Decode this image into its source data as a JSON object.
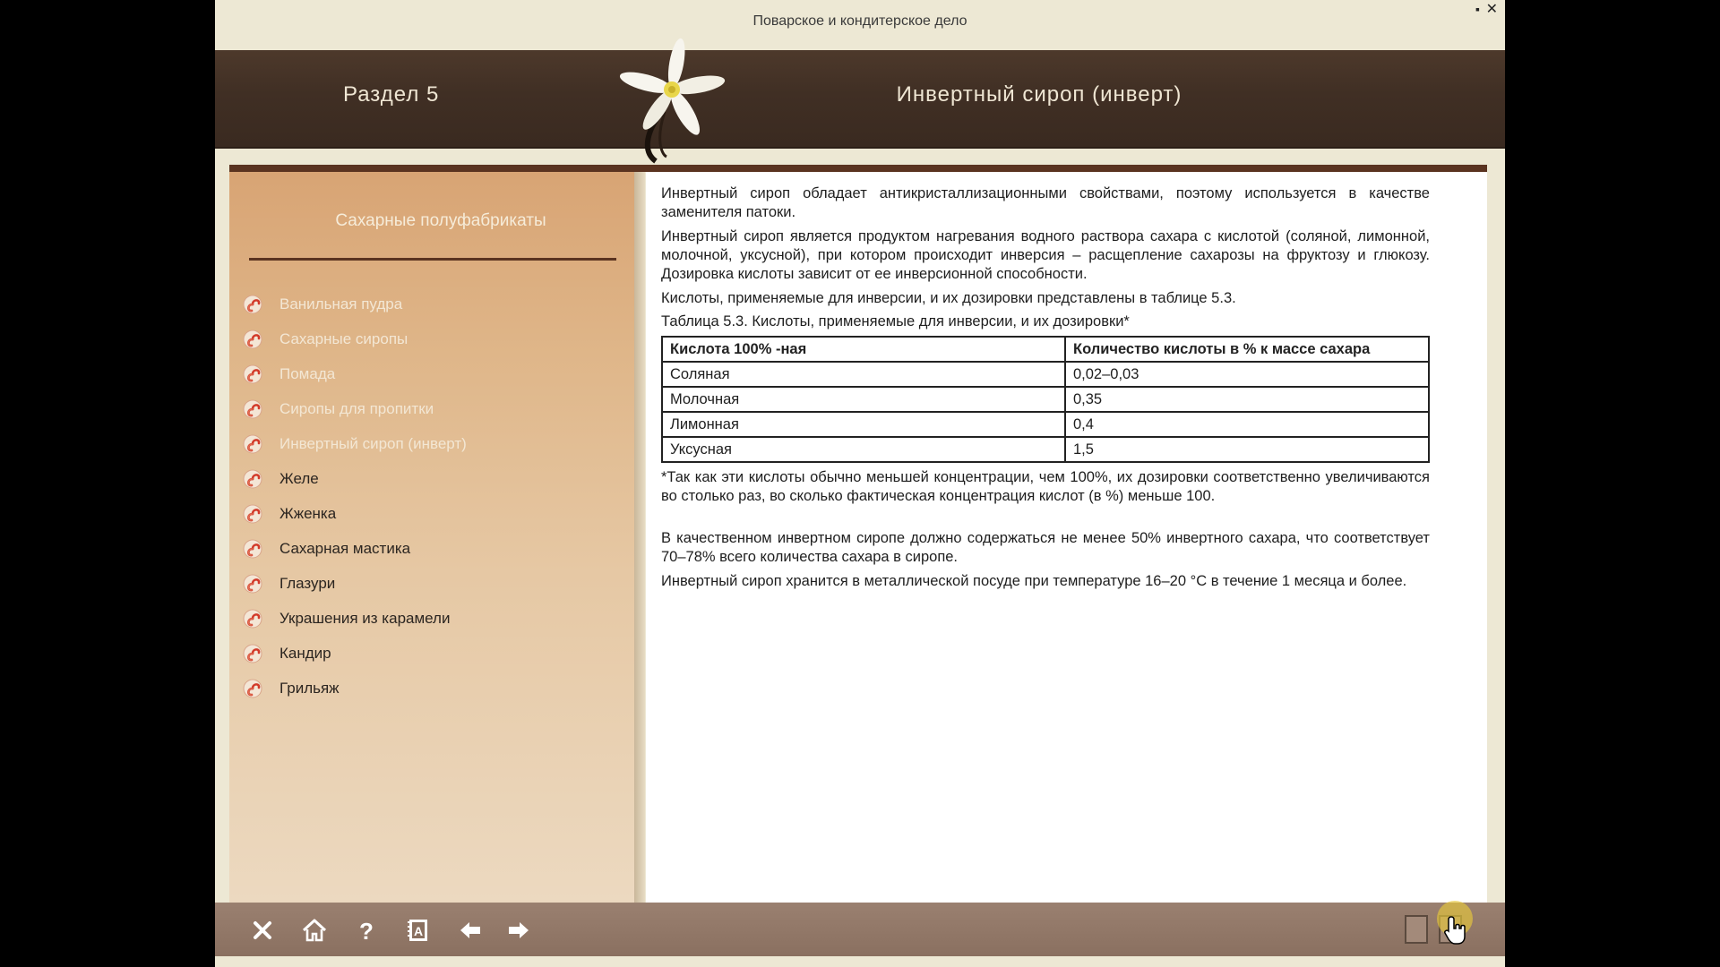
{
  "app": {
    "title": "Поварское и кондитерское дело",
    "minimize_glyph": "▪",
    "close_glyph": "✕"
  },
  "header": {
    "section": "Раздел 5",
    "topic": "Инвертный сироп (инверт)"
  },
  "sidebar": {
    "title": "Сахарные полуфабрикаты",
    "items": [
      {
        "label": "Ванильная пудра",
        "visited": true
      },
      {
        "label": "Сахарные сиропы",
        "visited": true
      },
      {
        "label": "Помада",
        "visited": true
      },
      {
        "label": "Сиропы для пропитки",
        "visited": true
      },
      {
        "label": "Инвертный сироп (инверт)",
        "visited": true
      },
      {
        "label": "Желе",
        "visited": false
      },
      {
        "label": "Жженка",
        "visited": false
      },
      {
        "label": "Сахарная мастика",
        "visited": false
      },
      {
        "label": "Глазури",
        "visited": false
      },
      {
        "label": "Украшения из карамели",
        "visited": false
      },
      {
        "label": "Кандир",
        "visited": false
      },
      {
        "label": "Грильяж",
        "visited": false
      }
    ]
  },
  "content": {
    "p1": "Инвертный сироп обладает антикристаллизационными свойствами, поэтому используется в качестве заменителя патоки.",
    "p2": "Инвертный сироп является продуктом нагревания водного раствора сахара с кислотой (соляной, лимонной, молочной, уксусной), при котором происходит инверсия – расщепление сахарозы на фруктозу и глюкозу. Дозировка кислоты зависит от ее инверсионной способности.",
    "p3": "Кислоты, применяемые для инверсии, и их дозировки представлены в таблице 5.3.",
    "table_caption": "Таблица 5.3. Кислоты, применяемые для инверсии, и их дозировки*",
    "table": {
      "headers": [
        "Кислота 100% -ная",
        "Количество кислоты в % к массе сахара"
      ],
      "rows": [
        [
          "Соляная",
          "0,02–0,03"
        ],
        [
          "Молочная",
          "0,35"
        ],
        [
          "Лимонная",
          "0,4"
        ],
        [
          "Уксусная",
          "1,5"
        ]
      ]
    },
    "footnote": "*Так как эти кислоты обычно меньшей концентрации, чем 100%, их дозировки соответственно увеличиваются во столько раз, во сколько фактическая концентрация кислот (в %) меньше 100.",
    "p4": "В качественном инвертном сиропе должно содержаться не менее 50% инвертного сахара, что соответствует 70–78% всего количества сахара в сиропе.",
    "p5": "Инвертный сироп хранится в металлической посуде при температуре 16–20 °C в течение 1 месяца и более."
  },
  "toolbar": {
    "buttons": [
      "close-icon",
      "home-icon",
      "help-icon",
      "glossary-icon",
      "arrow-left-icon",
      "arrow-right-icon"
    ],
    "accent": "#8a7060"
  },
  "colors": {
    "header_bg": "#402f24",
    "sidebar_top": "#d8a474",
    "sidebar_bottom": "#ecd9c0",
    "rule": "#5a3320",
    "icon_red": "#d23a2a"
  }
}
